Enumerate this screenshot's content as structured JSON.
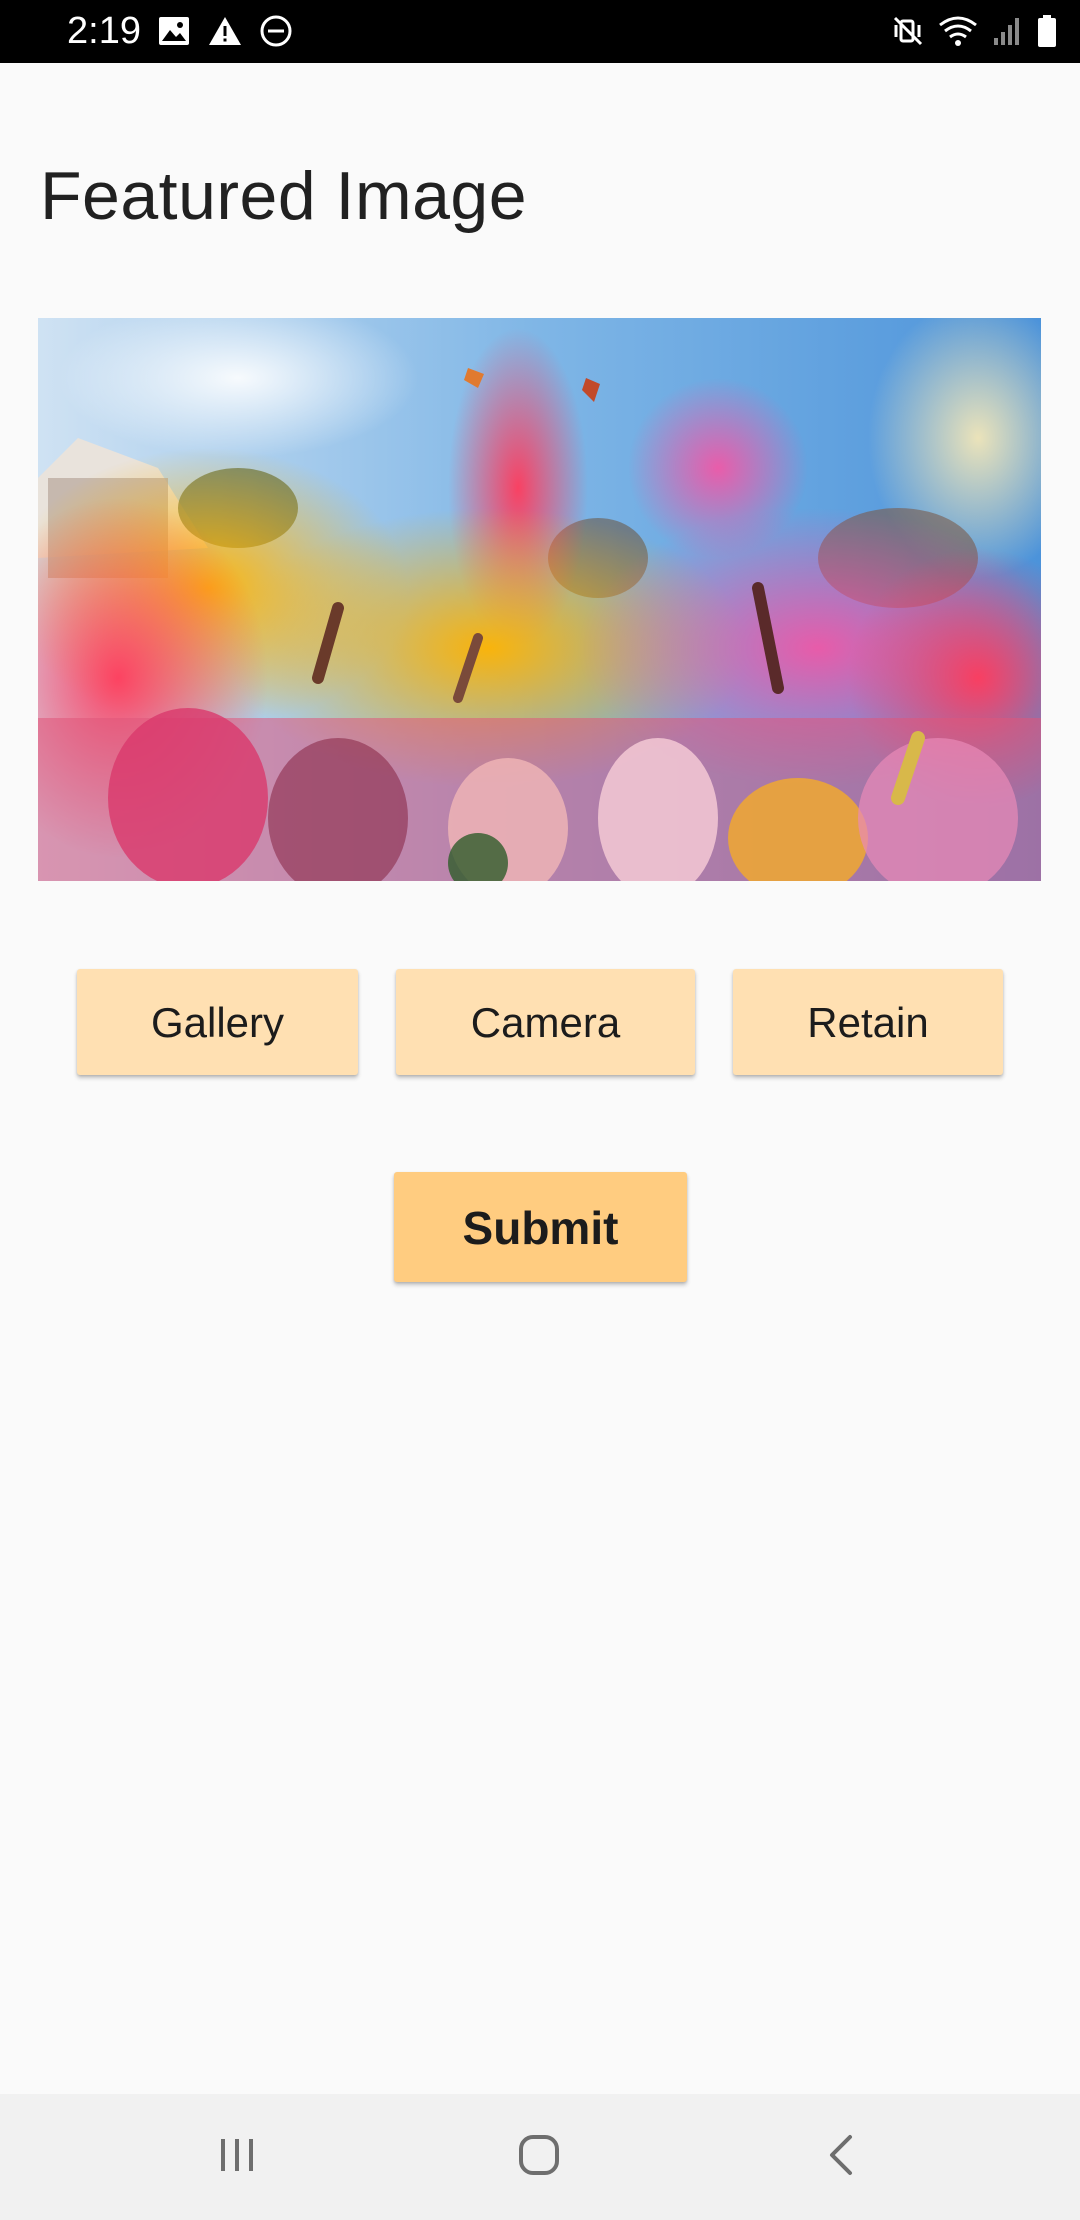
{
  "status_bar": {
    "time": "2:19",
    "left_icons": [
      "image-icon",
      "warning-icon",
      "do-not-disturb-icon"
    ],
    "right_icons": [
      "mute-vibrate-icon",
      "wifi-icon",
      "signal-icon",
      "battery-icon"
    ]
  },
  "page": {
    "title": "Featured Image"
  },
  "image": {
    "subject": "crowd throwing colored powder at festival"
  },
  "buttons": {
    "gallery": "Gallery",
    "camera": "Camera",
    "retain": "Retain",
    "submit": "Submit"
  },
  "nav_bar": {
    "icons": [
      "recents-icon",
      "home-icon",
      "back-icon"
    ]
  },
  "colors": {
    "button_light": "#ffe0b2",
    "button_submit": "#ffcc80",
    "background": "#fafafa",
    "status_bar": "#000000"
  }
}
